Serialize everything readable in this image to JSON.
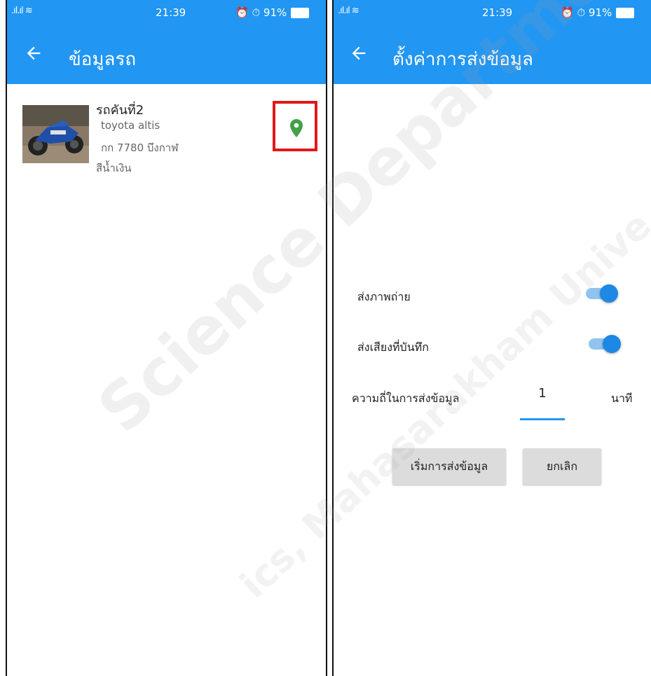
{
  "status_bar": {
    "signal": ".ıl.ıl ≋",
    "time": "21:39",
    "right": "⏰ ⏱ 91%"
  },
  "left_screen": {
    "title": "ข้อมูลรถ",
    "car": {
      "name": "รถคันที่2",
      "model": "toyota   altis",
      "plate": "กก 7780 บึงกาฬ",
      "color": "สีน้ำเงิน"
    }
  },
  "right_screen": {
    "title": "ตั้งค่าการส่งข้อมูล",
    "send_photo_label": "ส่งภาพถ่าย",
    "send_photo_on": true,
    "send_audio_label": "ส่งเสียงที่บันทึก",
    "send_audio_on": true,
    "frequency_label": "ความถี่ในการส่งข้อมูล",
    "frequency_value": "1",
    "frequency_unit": "นาที",
    "start_button": "เริ่มการส่งข้อมูล",
    "cancel_button": "ยกเลิก"
  },
  "watermark": {
    "line1": "Science Department",
    "line2": "ics, Mahasarakham Unive"
  },
  "colors": {
    "primary": "#2196f3",
    "pin": "#43a047",
    "highlight": "#e11919",
    "toggle_thumb": "#1e88e5"
  }
}
